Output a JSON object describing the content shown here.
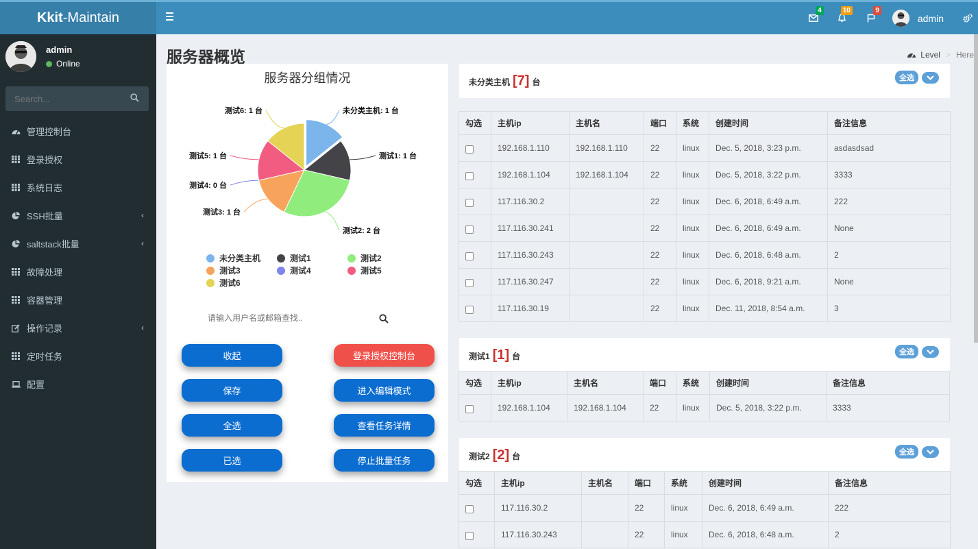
{
  "app": {
    "logo_bold": "Kkit",
    "logo_rest": "-Maintain"
  },
  "header": {
    "mail_count": "4",
    "bell_count": "10",
    "flag_count": "9",
    "user": "admin"
  },
  "sidebar": {
    "user_name": "admin",
    "status": "Online",
    "search_placeholder": "Search...",
    "items": [
      {
        "label": "管理控制台",
        "icon": "dashboard-icon",
        "chevron": false
      },
      {
        "label": "登录授权",
        "icon": "grid-icon",
        "chevron": false
      },
      {
        "label": "系统日志",
        "icon": "grid-icon",
        "chevron": false
      },
      {
        "label": "SSH批量",
        "icon": "pie-icon",
        "chevron": true
      },
      {
        "label": "saltstack批量",
        "icon": "pie-icon",
        "chevron": true
      },
      {
        "label": "故障处理",
        "icon": "grid-icon",
        "chevron": false
      },
      {
        "label": "容器管理",
        "icon": "grid-icon",
        "chevron": false
      },
      {
        "label": "操作记录",
        "icon": "edit-icon",
        "chevron": true
      },
      {
        "label": "定时任务",
        "icon": "grid-icon",
        "chevron": false
      },
      {
        "label": "配置",
        "icon": "laptop-icon",
        "chevron": false
      }
    ]
  },
  "page": {
    "title": "服务器概览",
    "breadcrumb_level": "Level",
    "breadcrumb_sep": ">",
    "breadcrumb_here": "Here"
  },
  "chart_data": {
    "type": "pie",
    "title": "服务器分组情况",
    "categories": [
      "未分类主机",
      "测试1",
      "测试2",
      "测试3",
      "测试4",
      "测试5",
      "测试6"
    ],
    "values": [
      1,
      1,
      2,
      1,
      0,
      1,
      1
    ],
    "labels": [
      "未分类主机: 1 台",
      "测试1: 1 台",
      "测试2: 2 台",
      "测试3: 1 台",
      "测试4: 0 台",
      "测试5: 1 台",
      "测试6: 1 台"
    ],
    "colors": [
      "#7cb5ec",
      "#434348",
      "#90ed7d",
      "#f7a35c",
      "#8085e9",
      "#f15c80",
      "#e4d354"
    ],
    "legend_position": "bottom"
  },
  "left_panel": {
    "search_placeholder": "请输入用户名或邮箱查找..",
    "buttons": {
      "collapse": "收起",
      "login_console": "登录授权控制台",
      "save": "保存",
      "edit_mode": "进入编辑模式",
      "select_all": "全选",
      "task_detail": "查看任务详情",
      "selected": "已选",
      "stop_task": "停止批量任务"
    }
  },
  "groups": [
    {
      "name": "未分类主机",
      "count_text": "[7]",
      "unit": "台",
      "select_all": "全选",
      "columns": [
        "勾选",
        "主机ip",
        "主机名",
        "端口",
        "系统",
        "创建时间",
        "备注信息"
      ],
      "rows": [
        [
          "192.168.1.110",
          "192.168.1.110",
          "22",
          "linux",
          "Dec. 5, 2018, 3:23 p.m.",
          "asdasdsad"
        ],
        [
          "192.168.1.104",
          "192.168.1.104",
          "22",
          "linux",
          "Dec. 5, 2018, 3:22 p.m.",
          "3333"
        ],
        [
          "117.116.30.2",
          "",
          "22",
          "linux",
          "Dec. 6, 2018, 6:49 a.m.",
          "222"
        ],
        [
          "117.116.30.241",
          "",
          "22",
          "linux",
          "Dec. 6, 2018, 6:49 a.m.",
          "None"
        ],
        [
          "117.116.30.243",
          "",
          "22",
          "linux",
          "Dec. 6, 2018, 6:48 a.m.",
          "2"
        ],
        [
          "117.116.30.247",
          "",
          "22",
          "linux",
          "Dec. 6, 2018, 9:21 a.m.",
          "None"
        ],
        [
          "117.116.30.19",
          "",
          "22",
          "linux",
          "Dec. 11, 2018, 8:54 a.m.",
          "3"
        ]
      ]
    },
    {
      "name": "测试1",
      "count_text": "[1]",
      "unit": "台",
      "select_all": "全选",
      "columns": [
        "勾选",
        "主机ip",
        "主机名",
        "端口",
        "系统",
        "创建时间",
        "备注信息"
      ],
      "rows": [
        [
          "192.168.1.104",
          "192.168.1.104",
          "22",
          "linux",
          "Dec. 5, 2018, 3:22 p.m.",
          "3333"
        ]
      ]
    },
    {
      "name": "测试2",
      "count_text": "[2]",
      "unit": "台",
      "select_all": "全选",
      "columns": [
        "勾选",
        "主机ip",
        "主机名",
        "端口",
        "系统",
        "创建时间",
        "备注信息"
      ],
      "rows": [
        [
          "117.116.30.2",
          "",
          "22",
          "linux",
          "Dec. 6, 2018, 6:49 a.m.",
          "222"
        ],
        [
          "117.116.30.243",
          "",
          "22",
          "linux",
          "Dec. 6, 2018, 6:48 a.m.",
          "2"
        ]
      ]
    }
  ]
}
